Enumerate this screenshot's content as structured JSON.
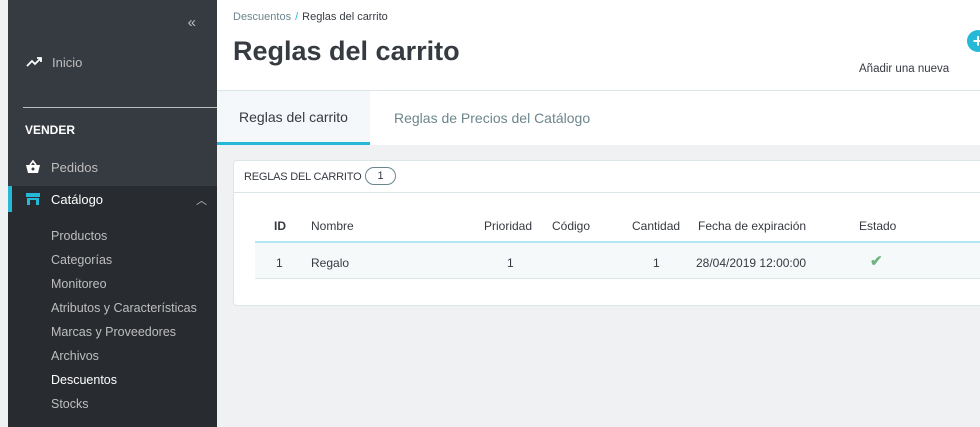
{
  "sidebar": {
    "collapse_glyph": "«",
    "home_label": "Inicio",
    "section_title": "VENDER",
    "orders_label": "Pedidos",
    "catalog_label": "Catálogo",
    "catalog_sub": [
      "Productos",
      "Categorías",
      "Monitoreo",
      "Atributos y Características",
      "Marcas y Proveedores",
      "Archivos",
      "Descuentos",
      "Stocks"
    ],
    "active_sub": "Descuentos"
  },
  "header": {
    "breadcrumb_parent": "Descuentos",
    "breadcrumb_sep": "/",
    "breadcrumb_current": "Reglas del carrito",
    "title": "Reglas del carrito",
    "add_label": "Añadir una nueva"
  },
  "tabs": {
    "tab1": "Reglas del carrito",
    "tab2": "Reglas de Precios del Catálogo"
  },
  "panel": {
    "title": "Reglas del carrito",
    "count": "1",
    "columns": {
      "id": "ID",
      "name": "Nombre",
      "priority": "Prioridad",
      "code": "Código",
      "quantity": "Cantidad",
      "expiration": "Fecha de expiración",
      "status": "Estado"
    },
    "rows": [
      {
        "id": "1",
        "name": "Regalo",
        "priority": "1",
        "code": "",
        "quantity": "1",
        "expiration": "28/04/2019 12:00:00",
        "status_glyph": "✔"
      }
    ]
  },
  "colors": {
    "accent": "#25b9d7",
    "sidebar_bg": "#363a41",
    "success": "#70b580"
  }
}
